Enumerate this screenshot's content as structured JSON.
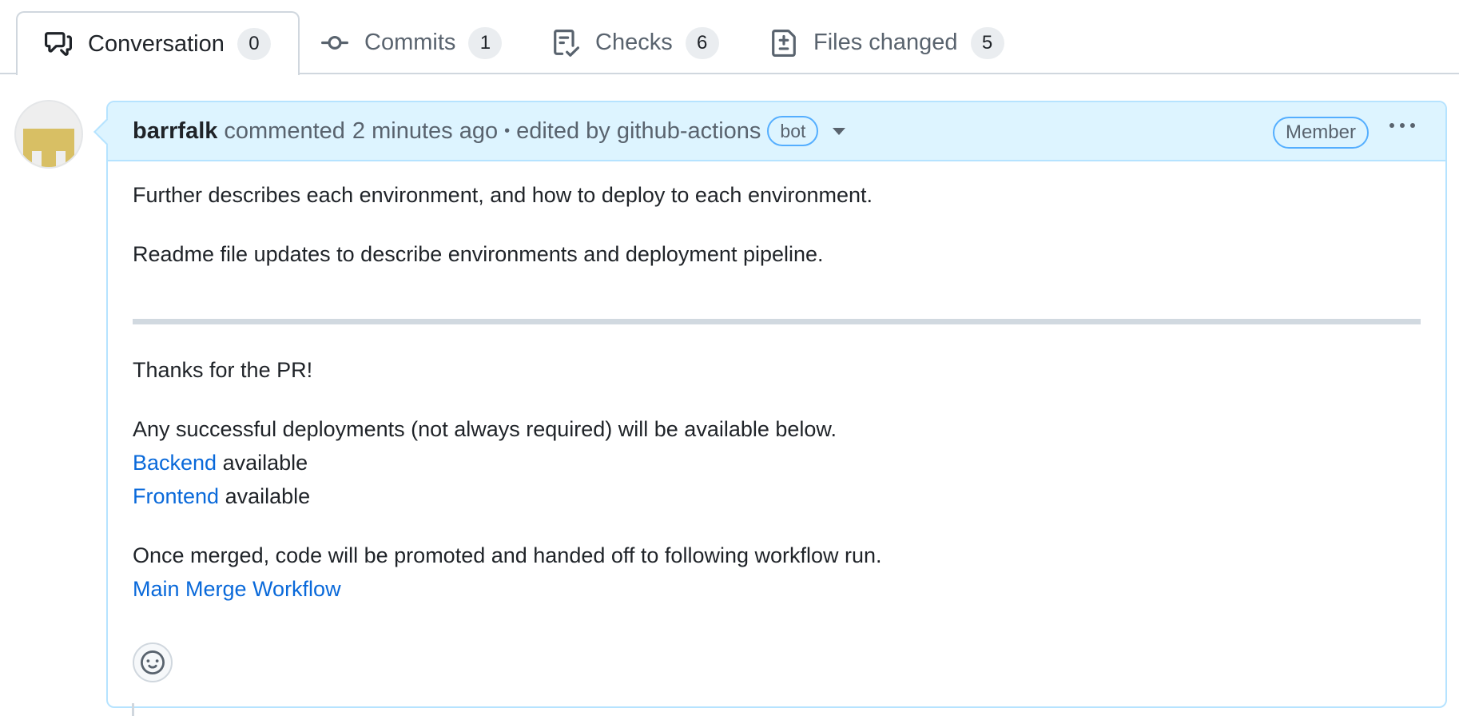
{
  "tabs": [
    {
      "label": "Conversation",
      "count": "0",
      "icon": "comment-discussion-icon"
    },
    {
      "label": "Commits",
      "count": "1",
      "icon": "git-commit-icon"
    },
    {
      "label": "Checks",
      "count": "6",
      "icon": "checklist-icon"
    },
    {
      "label": "Files changed",
      "count": "5",
      "icon": "file-diff-icon"
    }
  ],
  "comment": {
    "author": "barrfalk",
    "action": "commented",
    "time": "2 minutes ago",
    "separator": "•",
    "edited_by": "edited by github-actions",
    "bot_label": "bot",
    "role_label": "Member",
    "body": {
      "p1": "Further describes each environment, and how to deploy to each environment.",
      "p2": "Readme file updates to describe environments and deployment pipeline.",
      "p3": "Thanks for the PR!",
      "p4": "Any successful deployments (not always required) will be available below.",
      "backend_link": "Backend",
      "backend_suffix": " available",
      "frontend_link": "Frontend",
      "frontend_suffix": " available",
      "p5": "Once merged, code will be promoted and handed off to following workflow run.",
      "workflow_link": "Main Merge Workflow"
    }
  },
  "colors": {
    "header_bg": "#ddf4ff",
    "header_border": "#b6e3ff",
    "link": "#0969da",
    "avatar_identicon": "#d8bf64"
  }
}
